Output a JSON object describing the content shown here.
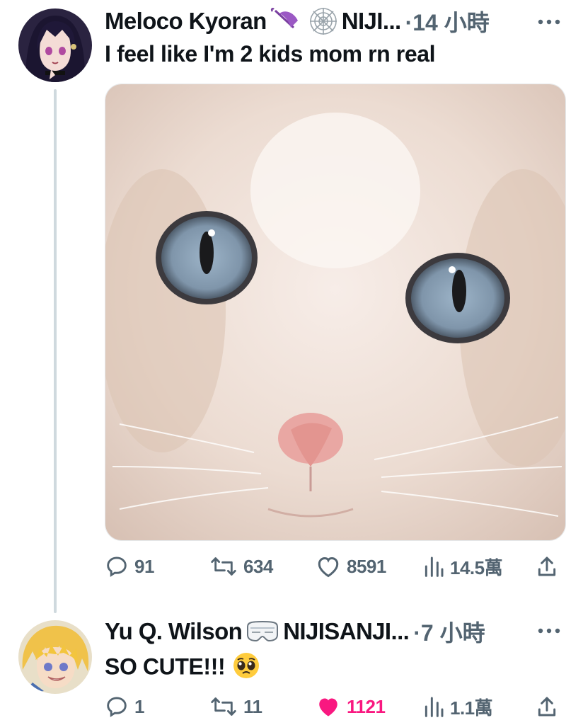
{
  "tweets": [
    {
      "author": "Meloco Kyoran",
      "badge_icon": "umbrella-icon",
      "badge2_icon": "spiderweb-icon",
      "handle": "NIJI...",
      "time": "·14 小時",
      "text": "I feel like I'm 2 kids mom rn real",
      "media_alt": "close-up of a white kitten with blue eyes",
      "stats": {
        "replies": "91",
        "retweets": "634",
        "likes": "8591",
        "views": "14.5萬"
      }
    },
    {
      "author": "Yu Q. Wilson",
      "badge_icon": "vr-goggles-icon",
      "handle": "NIJISANJI...",
      "time": "·7 小時",
      "text": "SO CUTE!!!",
      "emoji": "pleading-face-emoji",
      "stats": {
        "replies": "1",
        "retweets": "11",
        "likes": "1121",
        "views": "1.1萬"
      },
      "liked": true
    }
  ],
  "colors": {
    "text": "#0f1419",
    "muted": "#536471",
    "like": "#f91880",
    "thread_line": "#cfd9de"
  }
}
